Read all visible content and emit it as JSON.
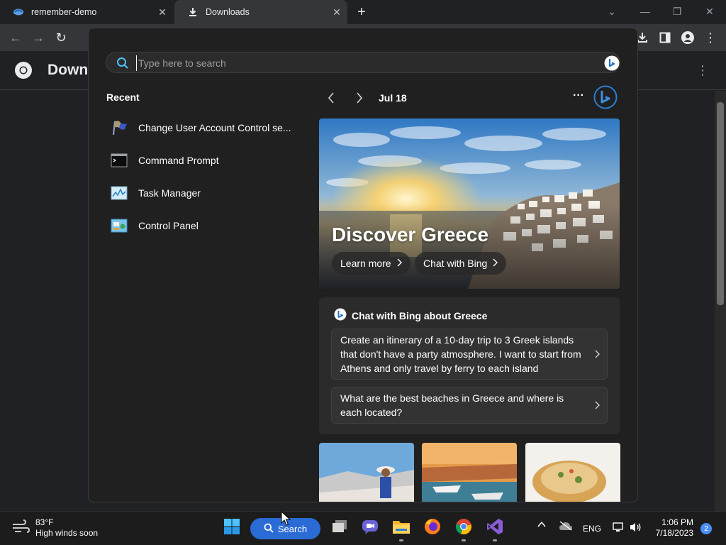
{
  "browser": {
    "tabs": [
      {
        "label": "remember-demo",
        "icon": "app-favicon",
        "active": false
      },
      {
        "label": "Downloads",
        "icon": "download-icon",
        "active": true
      }
    ],
    "new_tab_label": "+",
    "page_title": "Down",
    "window_controls": [
      "tab-search",
      "minimize",
      "restore",
      "close"
    ]
  },
  "search_panel": {
    "search_placeholder": "Type here to search",
    "recent_title": "Recent",
    "recent_items": [
      {
        "label": "Change User Account Control se...",
        "icon": "uac-flag-icon"
      },
      {
        "label": "Command Prompt",
        "icon": "command-prompt-icon"
      },
      {
        "label": "Task Manager",
        "icon": "task-manager-icon"
      },
      {
        "label": "Control Panel",
        "icon": "control-panel-icon"
      }
    ],
    "date_label": "Jul 18",
    "more_label": "···",
    "hero": {
      "title": "Discover Greece",
      "learn_more": "Learn more",
      "chat_with_bing": "Chat with Bing"
    },
    "chat_card": {
      "title": "Chat with Bing about Greece",
      "prompts": [
        "Create an itinerary of a 10-day trip to 3 Greek islands that don't have a party atmosphere. I want to start from Athens and only travel by ferry to each island",
        "What are the best beaches in Greece and where is each located?"
      ]
    }
  },
  "taskbar": {
    "weather_temp": "83°F",
    "weather_desc": "High winds soon",
    "search_label": "Search",
    "language": "ENG",
    "time": "1:06 PM",
    "date": "7/18/2023",
    "notification_count": "2"
  },
  "colors": {
    "panel_bg": "#202020",
    "card_bg": "#2b2b2b",
    "accent_blue": "#2b6bd6",
    "chrome_toolbar": "#35363a"
  }
}
